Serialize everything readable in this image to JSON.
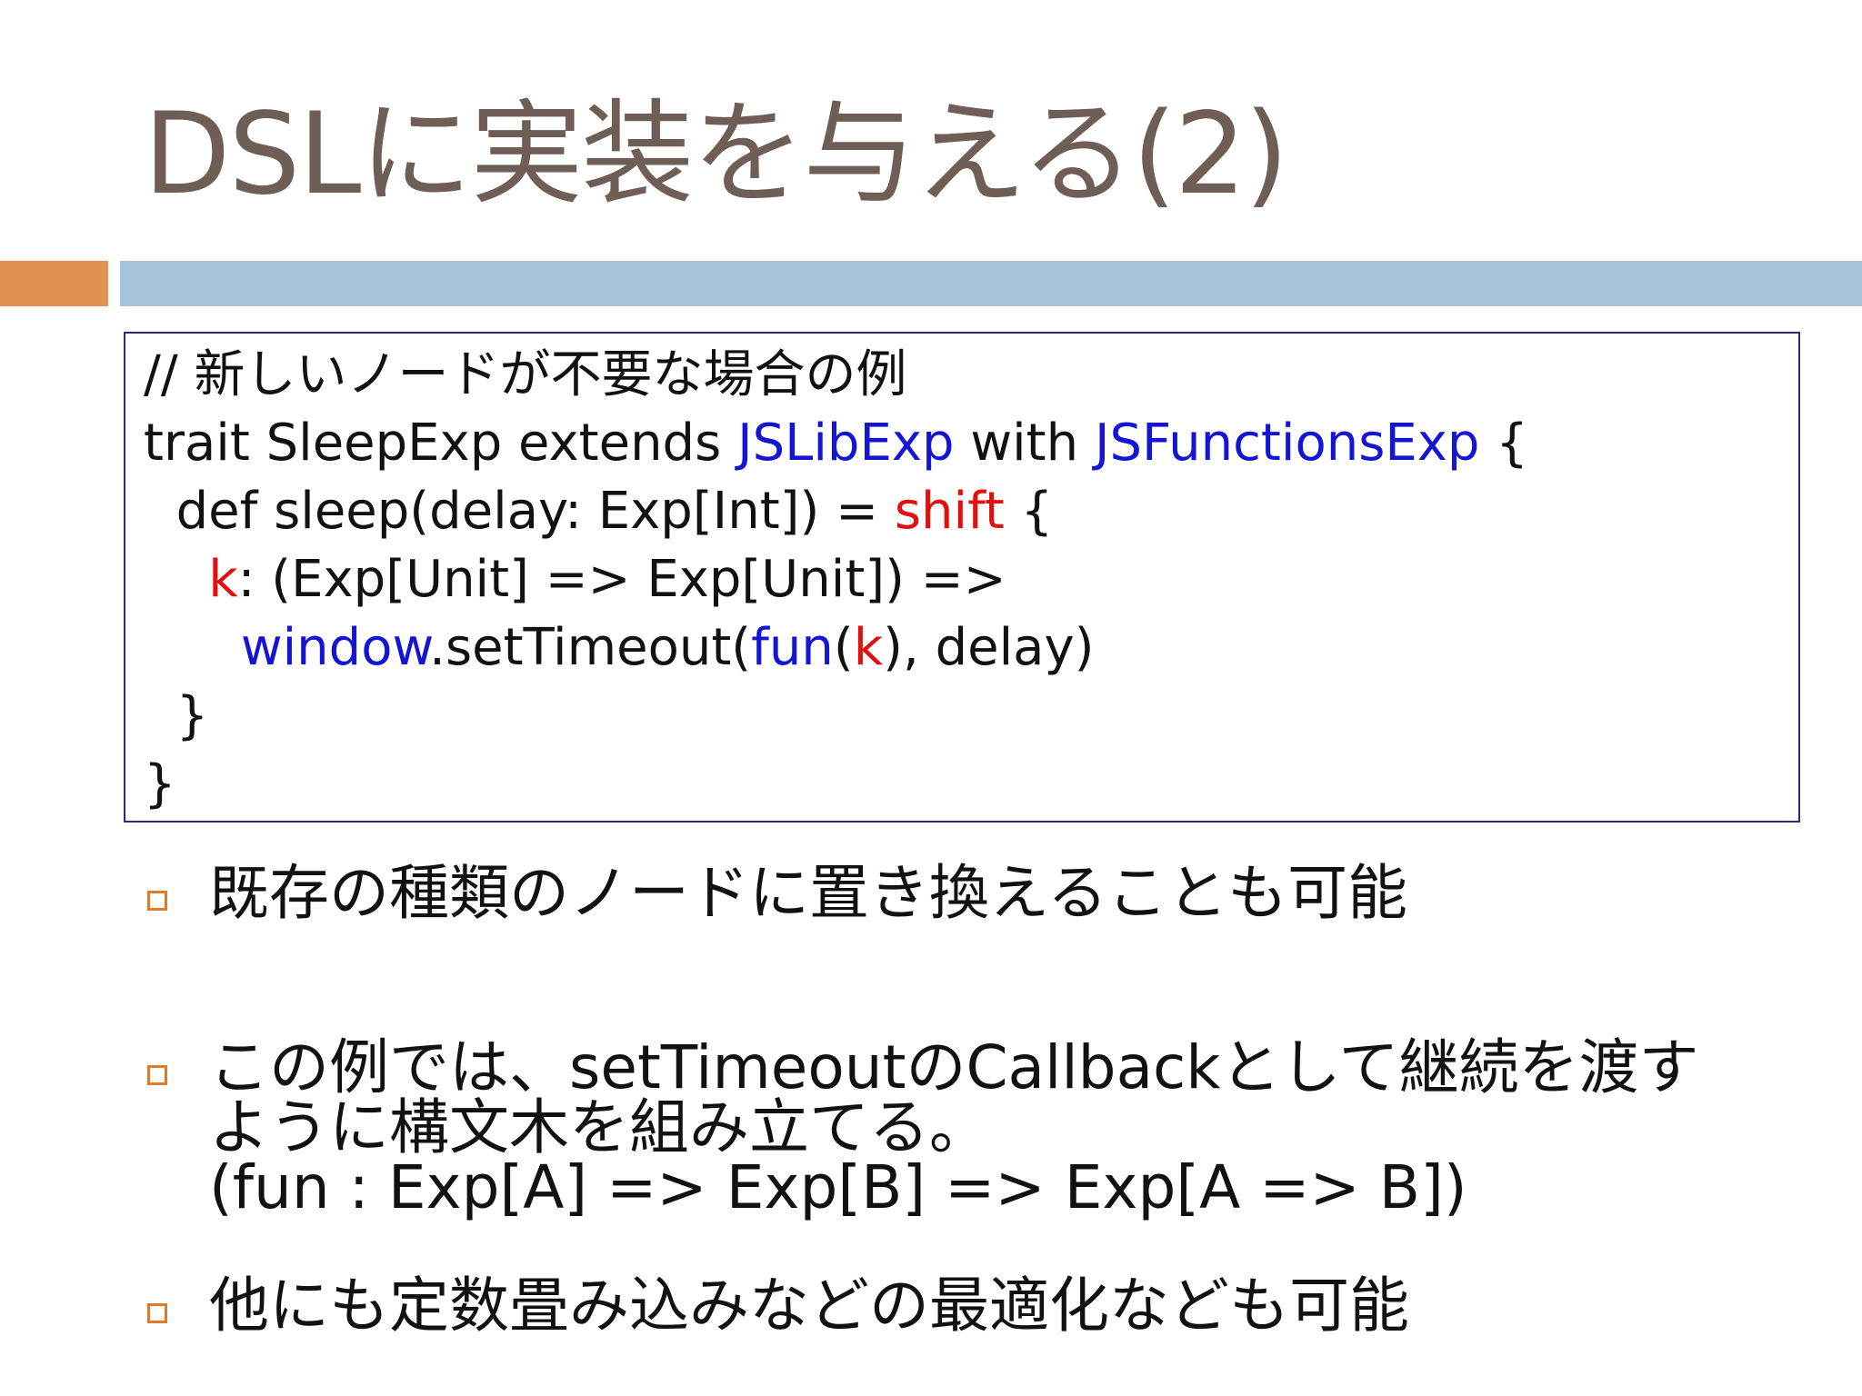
{
  "slide": {
    "title": "DSLに実装を与える(2)"
  },
  "code": {
    "l1": "// 新しいノードが不要な場合の例",
    "l2a": "trait SleepExp extends ",
    "l2b": "JSLibExp",
    "l2c": " with ",
    "l2d": "JSFunctionsExp",
    "l2e": " {",
    "l3a": "  def sleep(delay: Exp[Int]) = ",
    "l3b": "shift",
    "l3c": " {",
    "l4a": "    ",
    "l4b": "k",
    "l4c": ": (Exp[Unit] => Exp[Unit]) =>",
    "l5a": "      ",
    "l5b": "window",
    "l5c": ".setTimeout(",
    "l5d": "fun",
    "l5e": "(",
    "l5f": "k",
    "l5g": "), delay)",
    "l6": "  }",
    "l7": "}"
  },
  "bullets": {
    "b1": "既存の種類のノードに置き換えることも可能",
    "b2_line1": "この例では、setTimeoutのCallbackとして継続を渡す",
    "b2_line2": "ように構文木を組み立てる。",
    "b2_line3": "(fun : Exp[A] => Exp[B] => Exp[A => B])",
    "b3": "他にも定数畳み込みなどの最適化なども可能"
  },
  "colors": {
    "title": "#6e5e55",
    "accent_orange": "#e39153",
    "accent_blue": "#a5c3da",
    "code_keyword_blue": "#1414d4",
    "code_keyword_red": "#e01010"
  }
}
